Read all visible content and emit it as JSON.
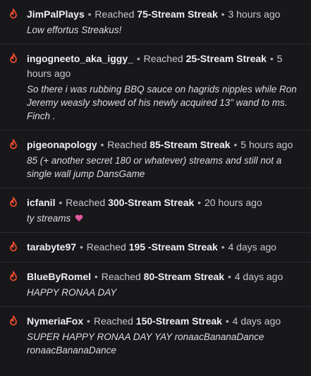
{
  "connector": "Reached",
  "separator": "•",
  "accent_color": "#ff4f2e",
  "icon": "flame-icon",
  "items": [
    {
      "user": "JimPalPlays",
      "streak": "75-Stream Streak",
      "time": "3 hours ago",
      "message": "Low effortus Streakus!"
    },
    {
      "user": "ingogneeto_aka_iggy_",
      "streak": "25-Stream Streak",
      "time": "5 hours ago",
      "message": "So there i was rubbing BBQ sauce on hagrids nipples while Ron Jeremy weasly showed of his newly acquired 13\" wand to ms. Finch ."
    },
    {
      "user": "pigeonapology",
      "streak": "85-Stream Streak",
      "time": "5 hours ago",
      "message": "85 (+ another secret 180 or whatever) streams and still not a single wall jump DansGame"
    },
    {
      "user": "icfanil",
      "streak": "300-Stream Streak",
      "time": "20 hours ago",
      "message": "ty streams",
      "emoji": "pink-heart-emoji"
    },
    {
      "user": "tarabyte97",
      "streak": "195 -Stream Streak",
      "time": "4 days ago",
      "message": ""
    },
    {
      "user": "BlueByRomel",
      "streak": "80-Stream Streak",
      "time": "4 days ago",
      "message": "HAPPY RONAA DAY"
    },
    {
      "user": "NymeriaFox",
      "streak": "150-Stream Streak",
      "time": "4 days ago",
      "message": "SUPER HAPPY RONAA DAY YAY ronaacBananaDance ronaacBananaDance"
    }
  ]
}
